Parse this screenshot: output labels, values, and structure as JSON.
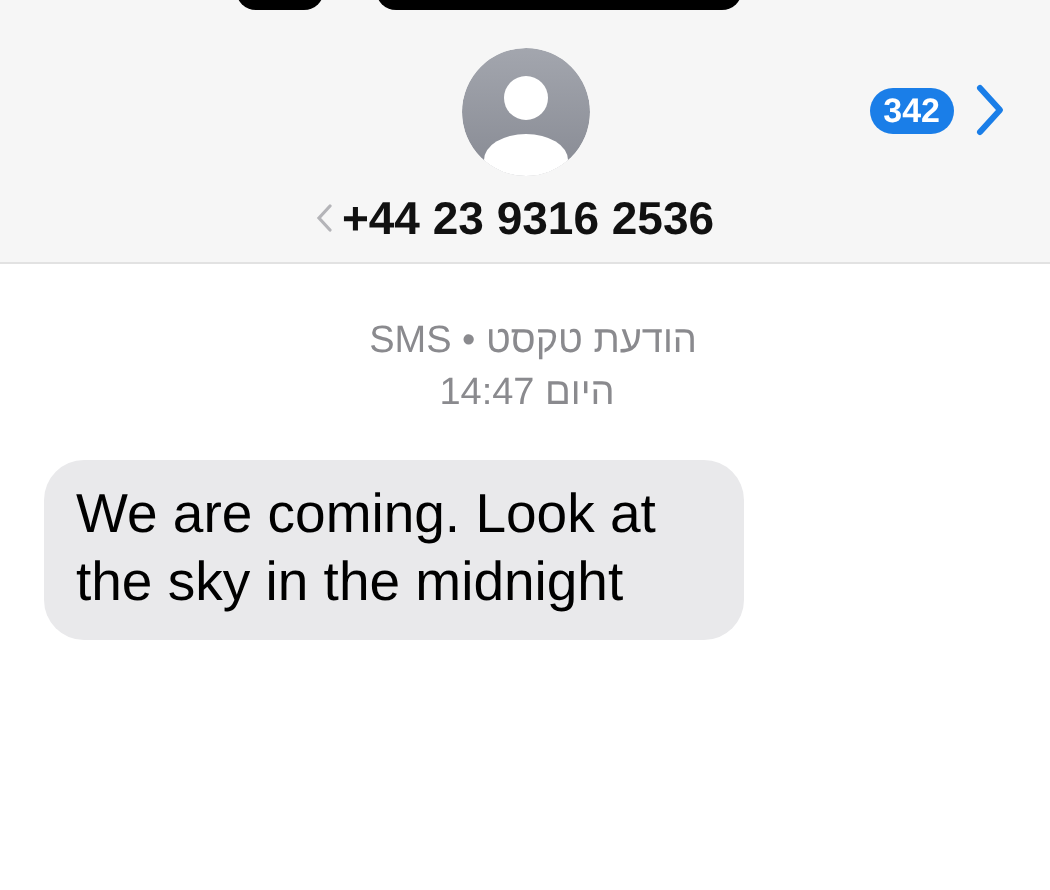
{
  "header": {
    "unread_badge": "342",
    "contact": "+44 23 9316 2536"
  },
  "thread": {
    "service": "הודעת טקסט • SMS",
    "timestamp": "היום 14:47",
    "messages": [
      {
        "kind": "incoming",
        "text": "We are coming. Look at the sky in the midnight"
      }
    ]
  }
}
